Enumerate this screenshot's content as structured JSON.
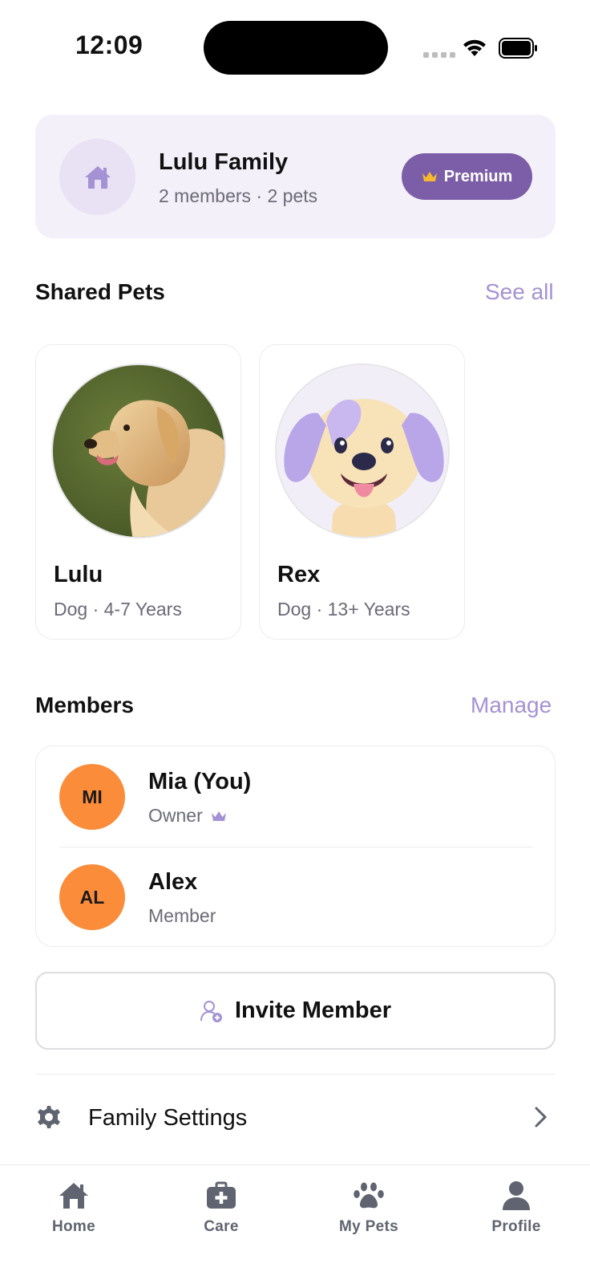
{
  "status_bar": {
    "time": "12:09"
  },
  "family": {
    "name": "Lulu Family",
    "meta": "2 members · 2 pets",
    "premium_label": "Premium",
    "home_icon": "home-icon",
    "crown_icon": "crown-icon"
  },
  "shared_pets": {
    "title": "Shared Pets",
    "link": "See all",
    "pets": [
      {
        "name": "Lulu",
        "meta": "Dog · 4-7 Years",
        "photo": "golden-retriever-photo"
      },
      {
        "name": "Rex",
        "meta": "Dog · 13+ Years",
        "photo": "cartoon-puppy-illustration"
      }
    ]
  },
  "members": {
    "title": "Members",
    "link": "Manage",
    "list": [
      {
        "initials": "MI",
        "name": "Mia (You)",
        "role": "Owner",
        "has_crown": true
      },
      {
        "initials": "AL",
        "name": "Alex",
        "role": "Member",
        "has_crown": false
      }
    ]
  },
  "invite": {
    "label": "Invite Member",
    "icon": "add-user-icon"
  },
  "settings": {
    "label": "Family Settings",
    "icon": "gear-icon"
  },
  "tab_bar": {
    "tabs": [
      {
        "label": "Home",
        "icon": "home-icon"
      },
      {
        "label": "Care",
        "icon": "medical-kit-icon"
      },
      {
        "label": "My Pets",
        "icon": "paw-icon"
      },
      {
        "label": "Profile",
        "icon": "person-icon"
      }
    ]
  },
  "colors": {
    "accent": "#7b5ea7",
    "accent_light": "#a592d4",
    "card_bg": "#f3f0f9",
    "avatar_orange": "#fb8c3a",
    "crown_gold": "#f5b82e"
  }
}
